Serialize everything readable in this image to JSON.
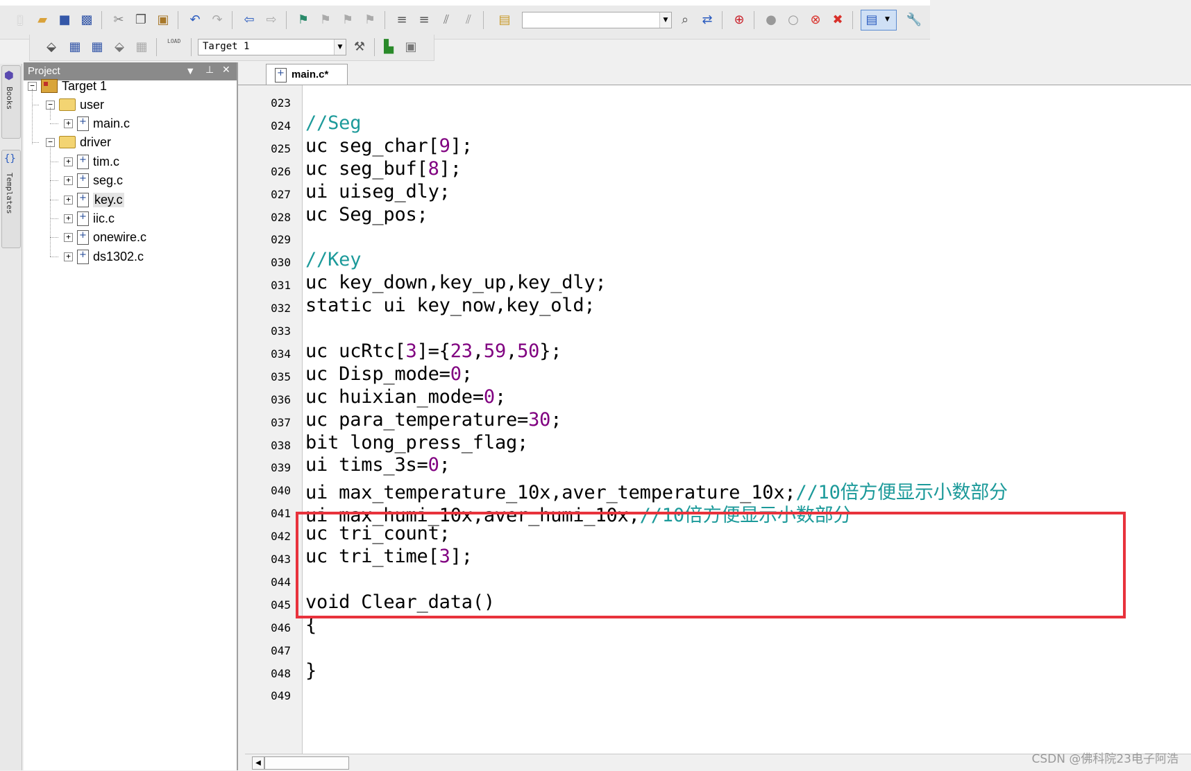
{
  "toolbar": {
    "find_combo_value": "",
    "target_combo_value": "Target 1",
    "load_label": "LOAD",
    "icons": [
      "new-file-icon",
      "open-icon",
      "save-icon",
      "save-all-icon",
      "cut-icon",
      "copy-icon",
      "paste-icon",
      "undo-icon",
      "redo-icon",
      "back-icon",
      "forward-icon",
      "bookmark-icon",
      "prev-bookmark-icon",
      "next-bookmark-icon",
      "clear-bookmarks-icon",
      "indent-icon",
      "unindent-icon",
      "comment-icon",
      "uncomment-icon",
      "find-in-files-icon",
      "find-icon",
      "incremental-find-icon",
      "debug-icon",
      "breakpoint-icon",
      "disable-breakpoint-icon",
      "disable-all-breakpoints-icon",
      "kill-breakpoints-icon",
      "window-icon",
      "configure-icon",
      "translate-icon",
      "build-icon",
      "rebuild-icon",
      "batch-build-icon",
      "stop-build-icon",
      "download-icon",
      "options-icon",
      "manage-components-icon",
      "select-packs-icon"
    ]
  },
  "sidebar_tabs": {
    "books": "Books",
    "templates": "Templates"
  },
  "project": {
    "title": "Project",
    "tree": [
      {
        "label": "Target 1",
        "kind": "target",
        "level": 0,
        "expander": "−"
      },
      {
        "label": "user",
        "kind": "folder",
        "level": 1,
        "expander": "−"
      },
      {
        "label": "main.c",
        "kind": "file",
        "level": 2,
        "expander": "+"
      },
      {
        "label": "driver",
        "kind": "folder",
        "level": 1,
        "expander": "−"
      },
      {
        "label": "tim.c",
        "kind": "file",
        "level": 2,
        "expander": "+"
      },
      {
        "label": "seg.c",
        "kind": "file",
        "level": 2,
        "expander": "+"
      },
      {
        "label": "key.c",
        "kind": "file",
        "level": 2,
        "expander": "+"
      },
      {
        "label": "iic.c",
        "kind": "file",
        "level": 2,
        "expander": "+"
      },
      {
        "label": "onewire.c",
        "kind": "file",
        "level": 2,
        "expander": "+"
      },
      {
        "label": "ds1302.c",
        "kind": "file",
        "level": 2,
        "expander": "+"
      }
    ]
  },
  "editor": {
    "tab_label": "main.c*",
    "lines": [
      {
        "num": "023",
        "segs": []
      },
      {
        "num": "024",
        "segs": [
          {
            "t": "//Seg",
            "c": "comment"
          }
        ]
      },
      {
        "num": "025",
        "segs": [
          {
            "t": "uc seg_char["
          },
          {
            "t": "9",
            "c": "num"
          },
          {
            "t": "];"
          }
        ]
      },
      {
        "num": "026",
        "segs": [
          {
            "t": "uc seg_buf["
          },
          {
            "t": "8",
            "c": "num"
          },
          {
            "t": "];"
          }
        ]
      },
      {
        "num": "027",
        "segs": [
          {
            "t": "ui uiseg_dly;"
          }
        ]
      },
      {
        "num": "028",
        "segs": [
          {
            "t": "uc Seg_pos;"
          }
        ]
      },
      {
        "num": "029",
        "segs": []
      },
      {
        "num": "030",
        "segs": [
          {
            "t": "//Key",
            "c": "comment"
          }
        ]
      },
      {
        "num": "031",
        "segs": [
          {
            "t": "uc key_down,key_up,key_dly;"
          }
        ]
      },
      {
        "num": "032",
        "segs": [
          {
            "t": "static ui key_now,key_old;"
          }
        ]
      },
      {
        "num": "033",
        "segs": []
      },
      {
        "num": "034",
        "segs": [
          {
            "t": "uc ucRtc["
          },
          {
            "t": "3",
            "c": "num"
          },
          {
            "t": "]={"
          },
          {
            "t": "23",
            "c": "num"
          },
          {
            "t": ","
          },
          {
            "t": "59",
            "c": "num"
          },
          {
            "t": ","
          },
          {
            "t": "50",
            "c": "num"
          },
          {
            "t": "};"
          }
        ]
      },
      {
        "num": "035",
        "segs": [
          {
            "t": "uc Disp_mode="
          },
          {
            "t": "0",
            "c": "num"
          },
          {
            "t": ";"
          }
        ]
      },
      {
        "num": "036",
        "segs": [
          {
            "t": "uc huixian_mode="
          },
          {
            "t": "0",
            "c": "num"
          },
          {
            "t": ";"
          }
        ]
      },
      {
        "num": "037",
        "segs": [
          {
            "t": "uc para_temperature="
          },
          {
            "t": "30",
            "c": "num"
          },
          {
            "t": ";"
          }
        ]
      },
      {
        "num": "038",
        "segs": [
          {
            "t": "bit long_press_flag;"
          }
        ]
      },
      {
        "num": "039",
        "segs": [
          {
            "t": "ui tims_3s="
          },
          {
            "t": "0",
            "c": "num"
          },
          {
            "t": ";"
          }
        ]
      },
      {
        "num": "040",
        "segs": [
          {
            "t": "ui max_temperature_10x,aver_temperature_10x;"
          },
          {
            "t": "//10倍方便显示小数部分",
            "c": "comment"
          }
        ]
      },
      {
        "num": "041",
        "segs": [
          {
            "t": "ui max_humi_10x,aver_humi_10x;"
          },
          {
            "t": "//10倍方便显示小数部分",
            "c": "comment"
          }
        ]
      },
      {
        "num": "042",
        "segs": [
          {
            "t": "uc tri_count;"
          }
        ]
      },
      {
        "num": "043",
        "segs": [
          {
            "t": "uc tri_time["
          },
          {
            "t": "3",
            "c": "num"
          },
          {
            "t": "];"
          }
        ]
      },
      {
        "num": "044",
        "segs": []
      },
      {
        "num": "045",
        "segs": [
          {
            "t": "void Clear_data()"
          }
        ]
      },
      {
        "num": "046",
        "segs": [
          {
            "t": "{"
          }
        ]
      },
      {
        "num": "047",
        "segs": []
      },
      {
        "num": "048",
        "segs": [
          {
            "t": "}"
          }
        ]
      },
      {
        "num": "049",
        "segs": []
      }
    ]
  },
  "colors": {
    "comment": "#1c9a9a",
    "number": "#800080",
    "highlight": "#e8323c"
  },
  "watermark": "CSDN @佛科院23电子阿浩"
}
